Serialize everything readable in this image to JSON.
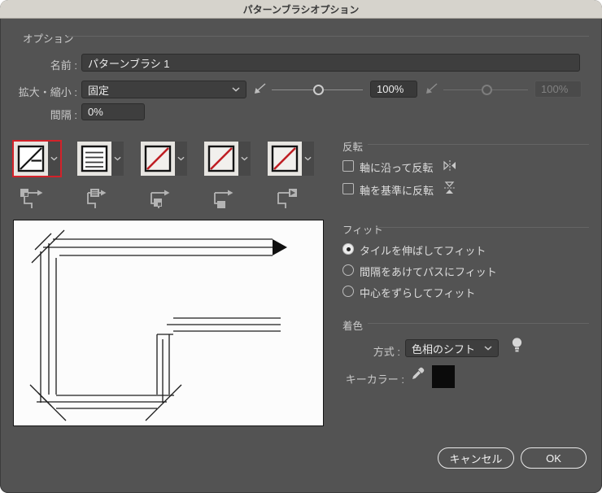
{
  "window": {
    "title": "パターンブラシオプション"
  },
  "colors": {
    "dialog_bg": "#535353",
    "titlebar_bg": "#d6d3cc",
    "accent_red": "#d3222a",
    "tile_slash_red": "#bf1e24",
    "key_color_swatch": "#000000"
  },
  "options": {
    "section_label": "オプション",
    "name_label": "名前 :",
    "name_value": "パターンブラシ 1",
    "scale_label": "拡大・縮小 :",
    "scale_mode": "固定",
    "scale_value": "100%",
    "scale_value_secondary": "100%",
    "spacing_label": "間隔 :",
    "spacing_value": "0%"
  },
  "tiles": {
    "items": [
      {
        "name": "outer-corner-tile",
        "pattern": "corner-lines",
        "selected": true
      },
      {
        "name": "side-tile",
        "pattern": "horizontal-lines",
        "selected": false
      },
      {
        "name": "inner-corner-tile",
        "pattern": "none",
        "selected": false
      },
      {
        "name": "start-tile",
        "pattern": "none",
        "selected": false
      },
      {
        "name": "end-tile",
        "pattern": "none",
        "selected": false
      }
    ]
  },
  "flip": {
    "section_label": "反転",
    "flip_along_label": "軸に沿って反転",
    "flip_along_checked": false,
    "flip_across_label": "軸を基準に反転",
    "flip_across_checked": false
  },
  "fit": {
    "section_label": "フィット",
    "options": [
      {
        "label": "タイルを伸ばしてフィット",
        "selected": true
      },
      {
        "label": "間隔をあけてパスにフィット",
        "selected": false
      },
      {
        "label": "中心をずらしてフィット",
        "selected": false
      }
    ]
  },
  "colorize": {
    "section_label": "着色",
    "method_label": "方式 :",
    "method_value": "色相のシフト",
    "key_color_label": "キーカラー :"
  },
  "footer": {
    "cancel_label": "キャンセル",
    "ok_label": "OK"
  }
}
